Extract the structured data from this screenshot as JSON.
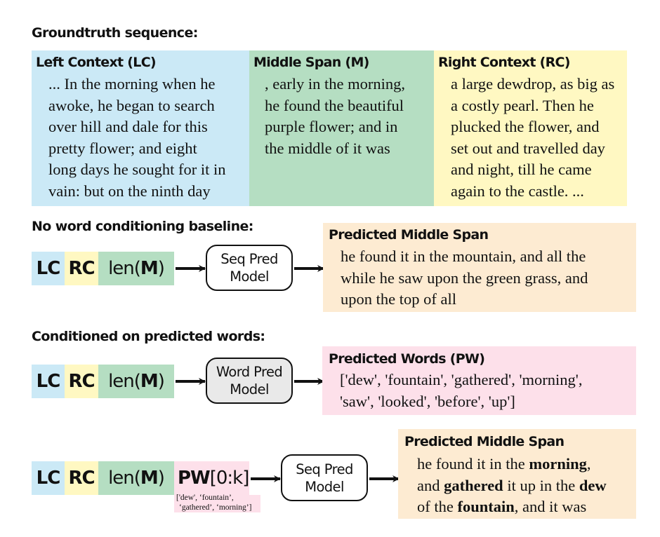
{
  "colors": {
    "left_context": "#cbe9f6",
    "middle_span": "#b5dec2",
    "right_context": "#fff8c2",
    "predicted_span": "#fdebd2",
    "predicted_words": "#fde0ea",
    "word_model_fill": "#e9e9e9"
  },
  "groundtruth": {
    "heading": "Groundtruth sequence:",
    "left_context": {
      "title": "Left Context (LC)",
      "lines": [
        "... In the morning when he",
        "awoke, he began to search",
        "over hill and dale for this",
        "pretty flower; and eight",
        "long days he sought for it in",
        "vain: but on the ninth day"
      ]
    },
    "middle_span": {
      "title": "Middle Span (M)",
      "lines": [
        ", early in the morning,",
        "he found the beautiful",
        "purple flower; and in",
        "the middle of it was"
      ]
    },
    "right_context": {
      "title": "Right Context (RC)",
      "lines": [
        "a large dewdrop, as big as",
        "a costly pearl. Then he",
        "plucked the flower, and",
        "set out and travelled day",
        "and night, till he came",
        "again to the castle. ..."
      ]
    }
  },
  "baseline": {
    "heading": "No word conditioning baseline:",
    "inputs": {
      "lc": "LC",
      "rc": "RC",
      "len_prefix": "len(",
      "len_var": "M",
      "len_suffix": ")"
    },
    "model": {
      "line1": "Seq Pred",
      "line2": "Model"
    },
    "output": {
      "title": "Predicted Middle Span",
      "lines": [
        "he found it in the mountain, and all the",
        "while he saw upon the green grass, and",
        "upon the top of all"
      ]
    }
  },
  "conditioned": {
    "heading": "Conditioned on predicted words:",
    "word_stage": {
      "inputs": {
        "lc": "LC",
        "rc": "RC",
        "len_prefix": "len(",
        "len_var": "M",
        "len_suffix": ")"
      },
      "model": {
        "line1": "Word Pred",
        "line2": "Model"
      },
      "output": {
        "title": "Predicted Words (PW)",
        "lines": [
          "['dew', 'fountain', 'gathered', 'morning',",
          "'saw', 'looked', 'before', 'up']"
        ]
      }
    },
    "seq_stage": {
      "inputs": {
        "lc": "LC",
        "rc": "RC",
        "len_prefix": "len(",
        "len_var": "M",
        "len_suffix": ")",
        "pw_bold": "PW",
        "pw_slice": "[0:k]"
      },
      "pw_example": {
        "line1": "['dew', ‘fountain’,",
        "line2": "‘gathered’, ‘morning’]"
      },
      "model": {
        "line1": "Seq Pred",
        "line2": "Model"
      },
      "output": {
        "title": "Predicted Middle Span",
        "lines": [
          [
            {
              "t": "he found it in the ",
              "b": false
            },
            {
              "t": "morning",
              "b": true
            },
            {
              "t": ",",
              "b": false
            }
          ],
          [
            {
              "t": "and ",
              "b": false
            },
            {
              "t": "gathered",
              "b": true
            },
            {
              "t": " it up in the ",
              "b": false
            },
            {
              "t": "dew",
              "b": true
            }
          ],
          [
            {
              "t": "of the ",
              "b": false
            },
            {
              "t": "fountain",
              "b": true
            },
            {
              "t": ", and it was",
              "b": false
            }
          ]
        ]
      }
    }
  }
}
